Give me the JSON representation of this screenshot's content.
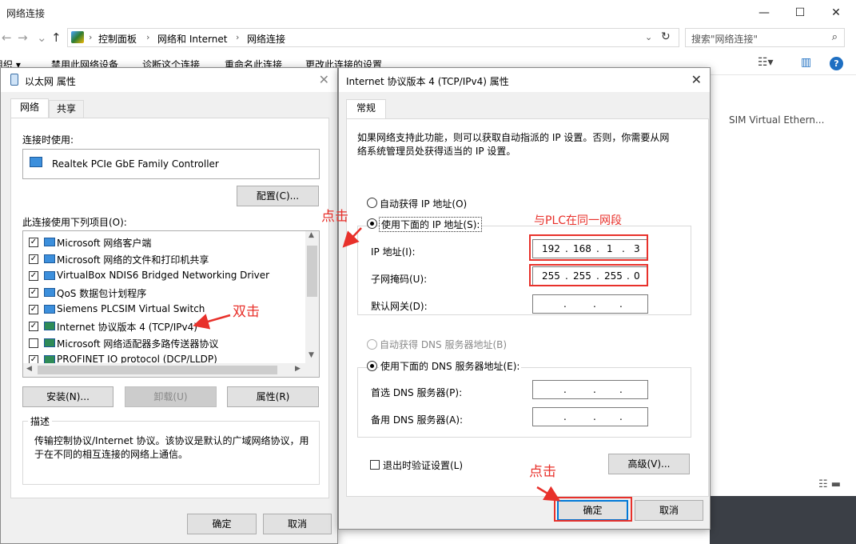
{
  "explorer": {
    "title": "网络连接",
    "window_controls": {
      "minimize": "—",
      "maximize": "☐",
      "close": "✕"
    },
    "breadcrumbs": [
      "控制面板",
      "网络和 Internet",
      "网络连接"
    ],
    "search_placeholder": "搜索\"网络连接\"",
    "toolbar": [
      "组织 ▾",
      "禁用此网络设备",
      "诊断这个连接",
      "重命名此连接",
      "更改此连接的设置"
    ],
    "partial_item": "SIM Virtual Ethern..."
  },
  "ethernet_dialog": {
    "title": "以太网 属性",
    "tabs": [
      "网络",
      "共享"
    ],
    "connect_using_label": "连接时使用:",
    "adapter": "Realtek PCIe GbE Family Controller",
    "configure_button": "配置(C)...",
    "items_label": "此连接使用下列项目(O):",
    "items": [
      {
        "label": "Microsoft 网络客户端",
        "checked": true
      },
      {
        "label": "Microsoft 网络的文件和打印机共享",
        "checked": true
      },
      {
        "label": "VirtualBox NDIS6 Bridged Networking Driver",
        "checked": true
      },
      {
        "label": "QoS 数据包计划程序",
        "checked": true
      },
      {
        "label": "Siemens PLCSIM Virtual Switch",
        "checked": true
      },
      {
        "label": "Internet 协议版本 4 (TCP/IPv4)",
        "checked": true
      },
      {
        "label": "Microsoft 网络适配器多路传送器协议",
        "checked": false
      },
      {
        "label": "PROFINET IO protocol (DCP/LLDP)",
        "checked": true
      }
    ],
    "install_button": "安装(N)...",
    "uninstall_button": "卸载(U)",
    "properties_button": "属性(R)",
    "description_label": "描述",
    "description_text": "传输控制协议/Internet 协议。该协议是默认的广域网络协议，用于在不同的相互连接的网络上通信。",
    "ok_button": "确定",
    "cancel_button": "取消"
  },
  "ipv4_dialog": {
    "title": "Internet 协议版本 4 (TCP/IPv4) 属性",
    "tab": "常规",
    "intro": "如果网络支持此功能，则可以获取自动指派的 IP 设置。否则，你需要从网络系统管理员处获得适当的 IP 设置。",
    "auto_ip": "自动获得 IP 地址(O)",
    "manual_ip": "使用下面的 IP 地址(S):",
    "ip_label": "IP 地址(I):",
    "ip_value": [
      "192",
      "168",
      "1",
      "3"
    ],
    "mask_label": "子网掩码(U):",
    "mask_value": [
      "255",
      "255",
      "255",
      "0"
    ],
    "gateway_label": "默认网关(D):",
    "auto_dns": "自动获得 DNS 服务器地址(B)",
    "manual_dns": "使用下面的 DNS 服务器地址(E):",
    "preferred_dns_label": "首选 DNS 服务器(P):",
    "alternate_dns_label": "备用 DNS 服务器(A):",
    "validate_on_exit": "退出时验证设置(L)",
    "advanced_button": "高级(V)...",
    "ok_button": "确定",
    "cancel_button": "取消"
  },
  "annotations": {
    "click_1": "点击",
    "same_segment": "与PLC在同一网段",
    "double_click": "双击",
    "click_2": "点击",
    "color": "#e8312b"
  }
}
